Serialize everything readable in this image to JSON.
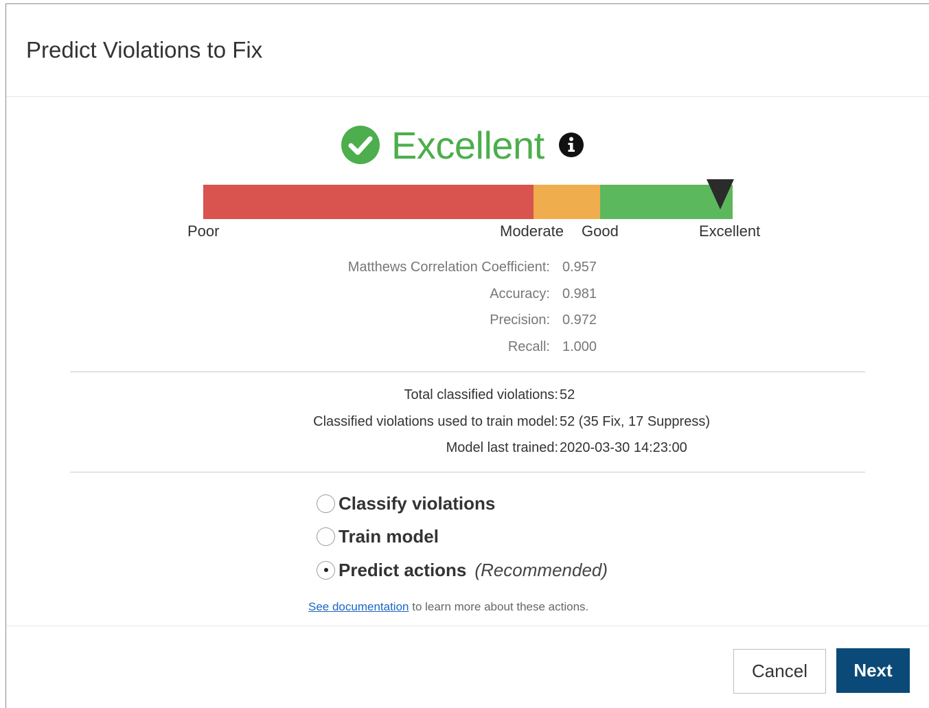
{
  "dialog": {
    "title": "Predict Violations to Fix"
  },
  "rating": {
    "label": "Excellent",
    "icon": "check-circle-icon",
    "info_icon": "info-circle-icon",
    "color": "#4cae4c"
  },
  "scale": {
    "labels": {
      "poor": "Poor",
      "moderate": "Moderate",
      "good": "Good",
      "excellent": "Excellent"
    },
    "colors": {
      "poor": "#d9534f",
      "moderate": "#f0ad4e",
      "good": "#5cb85c"
    },
    "marker_icon": "triangle-down-icon"
  },
  "metrics": [
    {
      "label": "Matthews Correlation Coefficient:",
      "value": "0.957"
    },
    {
      "label": "Accuracy:",
      "value": "0.981"
    },
    {
      "label": "Precision:",
      "value": "0.972"
    },
    {
      "label": "Recall:",
      "value": "1.000"
    }
  ],
  "stats": [
    {
      "label": "Total classified violations:",
      "value": "52"
    },
    {
      "label": "Classified violations used to train model:",
      "value": "52 (35 Fix, 17 Suppress)"
    },
    {
      "label": "Model last trained:",
      "value": "2020-03-30 14:23:00"
    }
  ],
  "options": [
    {
      "label": "Classify violations",
      "note": "",
      "checked": false
    },
    {
      "label": "Train model",
      "note": "",
      "checked": false
    },
    {
      "label": "Predict actions",
      "note": "(Recommended)",
      "checked": true
    }
  ],
  "documentation": {
    "link_text": "See documentation",
    "suffix": " to learn more about these actions."
  },
  "footer": {
    "cancel_label": "Cancel",
    "next_label": "Next",
    "next_color": "#0b4a78"
  }
}
